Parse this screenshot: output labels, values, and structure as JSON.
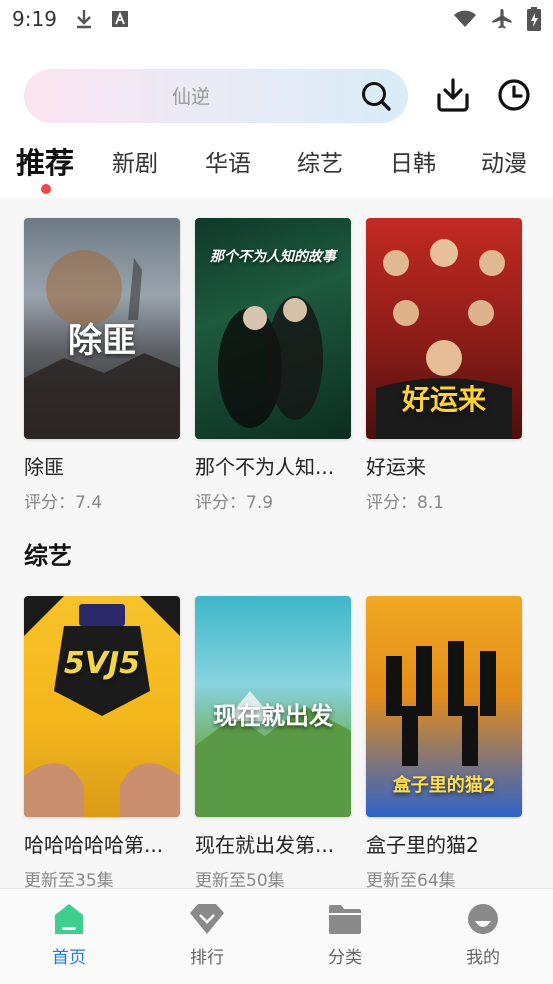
{
  "status": {
    "time": "9:19"
  },
  "search": {
    "placeholder": "仙逆"
  },
  "tabs": [
    {
      "label": "推荐"
    },
    {
      "label": "新剧"
    },
    {
      "label": "华语"
    },
    {
      "label": "综艺"
    },
    {
      "label": "日韩"
    },
    {
      "label": "动漫"
    }
  ],
  "recommend": [
    {
      "title": "除匪",
      "rating": "评分：7.4",
      "poster_text": "除匪"
    },
    {
      "title": "那个不为人知...",
      "rating": "评分：7.9",
      "poster_text": "那个不为人知的故事"
    },
    {
      "title": "好运来",
      "rating": "评分：8.1",
      "poster_text": "好运来"
    }
  ],
  "variety": {
    "heading": "综艺",
    "items": [
      {
        "title": "哈哈哈哈哈第...",
        "update": "更新至35集",
        "poster_text": "5VJ5"
      },
      {
        "title": "现在就出发第...",
        "update": "更新至50集",
        "poster_text": "现在就出发"
      },
      {
        "title": "盒子里的猫2",
        "update": "更新至64集",
        "poster_text": "盒子里的猫2"
      }
    ]
  },
  "nav": [
    {
      "label": "首页",
      "icon": "home-icon"
    },
    {
      "label": "排行",
      "icon": "rank-icon"
    },
    {
      "label": "分类",
      "icon": "folder-icon"
    },
    {
      "label": "我的",
      "icon": "profile-icon"
    }
  ],
  "colors": {
    "accent": "#1f7adf",
    "active_nav_icon": "#3ecf8e",
    "tab_dot": "#f04848"
  }
}
